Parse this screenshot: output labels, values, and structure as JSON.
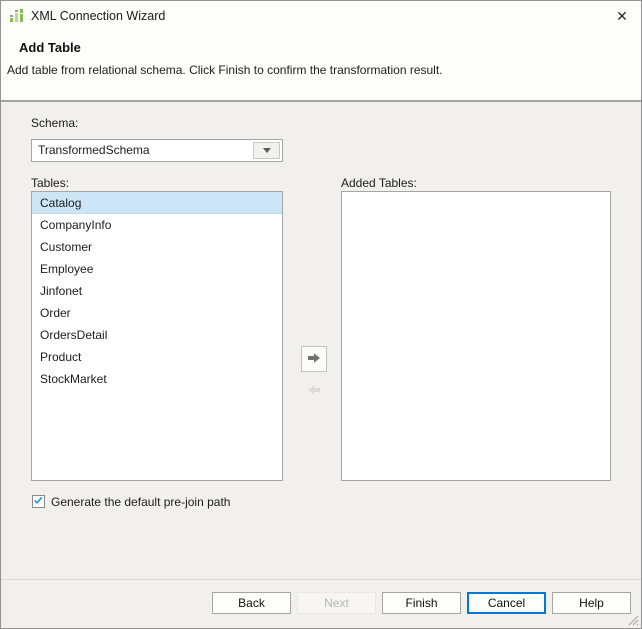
{
  "window": {
    "title": "XML Connection Wizard",
    "close_glyph": "✕"
  },
  "header": {
    "title": "Add Table",
    "subtitle": "Add table from relational schema. Click Finish to confirm the transformation result."
  },
  "schema": {
    "label": "Schema:",
    "value": "TransformedSchema"
  },
  "tables": {
    "label": "Tables:",
    "selected_index": 0,
    "items": [
      "Catalog",
      "CompanyInfo",
      "Customer",
      "Employee",
      "Jinfonet",
      "Order",
      "OrdersDetail",
      "Product",
      "StockMarket"
    ]
  },
  "added_tables": {
    "label": "Added Tables:",
    "items": []
  },
  "transfer": {
    "add_icon": "arrow-right-icon",
    "remove_icon": "arrow-left-icon",
    "remove_disabled": true
  },
  "prejoin": {
    "label": "Generate the default pre-join path",
    "checked": true
  },
  "footer": {
    "buttons": [
      {
        "label": "Back",
        "state": "enabled"
      },
      {
        "label": "Next",
        "state": "disabled"
      },
      {
        "label": "Finish",
        "state": "enabled"
      },
      {
        "label": "Cancel",
        "state": "default"
      },
      {
        "label": "Help",
        "state": "enabled"
      }
    ]
  },
  "colors": {
    "selection_bg": "#cde6f7",
    "accent_blue": "#0078d7",
    "check_blue": "#2696dc",
    "icon_green": "#86c04a"
  }
}
